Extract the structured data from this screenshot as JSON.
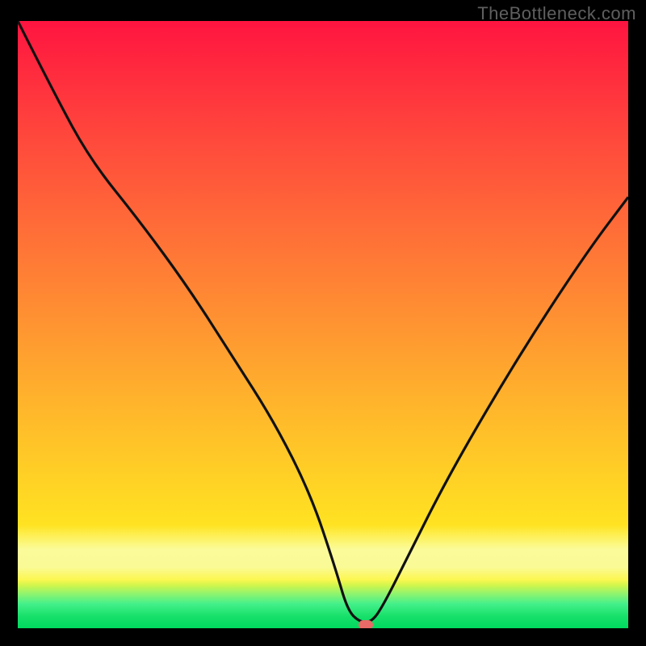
{
  "watermark": "TheBottleneck.com",
  "colors": {
    "curve_stroke": "#111111",
    "marker_fill": "#e96a66",
    "frame_bg": "#000000"
  },
  "chart_data": {
    "type": "line",
    "title": "",
    "xlabel": "",
    "ylabel": "",
    "xlim": [
      0,
      100
    ],
    "ylim": [
      0,
      100
    ],
    "grid": false,
    "series": [
      {
        "name": "bottleneck-curve",
        "x": [
          0,
          6,
          12,
          20,
          28,
          35,
          42,
          48,
          52,
          54,
          56,
          58,
          60,
          64,
          70,
          78,
          86,
          94,
          100
        ],
        "values": [
          100,
          88,
          77,
          67,
          56,
          45,
          34,
          22,
          10,
          3,
          1,
          1,
          4,
          12,
          24,
          38,
          51,
          63,
          71
        ]
      }
    ],
    "annotations": [
      {
        "name": "optimal-marker",
        "x": 57,
        "y": 0.5
      }
    ]
  }
}
